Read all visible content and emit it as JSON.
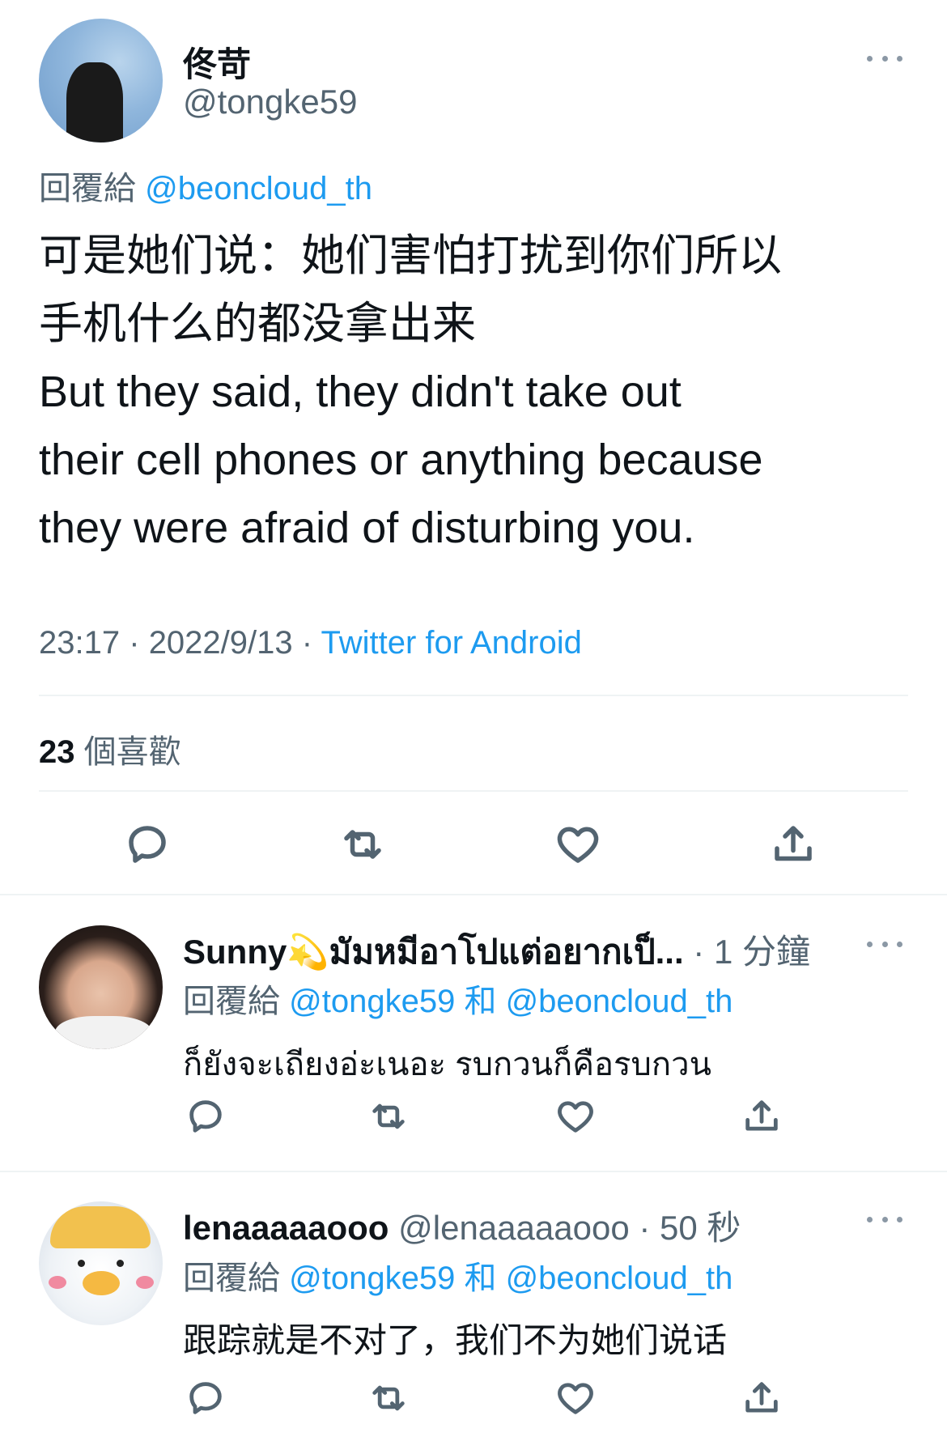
{
  "main_tweet": {
    "author_name": "佟苛",
    "author_handle": "@tongke59",
    "reply_prefix": "回覆給",
    "reply_to": "@beoncloud_th",
    "text_line1": "可是她们说：她们害怕打扰到你们所以",
    "text_line2": "手机什么的都没拿出来",
    "text_line3": "But they said, they didn't take out",
    "text_line4": "their cell phones or anything because",
    "text_line5": "they were afraid of disturbing you.",
    "time": "23:17",
    "separator": "·",
    "date": "2022/9/13",
    "source": "Twitter for Android",
    "likes_count": "23",
    "likes_label": "個喜歡"
  },
  "replies": [
    {
      "author_name": "Sunny💫มัมหมีอาโปแต่อยากเป็...",
      "author_handle": "",
      "time": "· 1 分鐘",
      "reply_prefix": "回覆給",
      "reply_to_1": "@tongke59",
      "conjunction": "和",
      "reply_to_2": "@beoncloud_th",
      "text": "ก็ยังจะเถียงอ่ะเนอะ รบกวนก็คือรบกวน"
    },
    {
      "author_name": "lenaaaaaooo",
      "author_handle": "@lenaaaaaooo",
      "time": "· 50 秒",
      "reply_prefix": "回覆給",
      "reply_to_1": "@tongke59",
      "conjunction": "和",
      "reply_to_2": "@beoncloud_th",
      "text": "跟踪就是不对了，我们不为她们说话"
    }
  ],
  "icons": {
    "reply": "reply-icon",
    "retweet": "retweet-icon",
    "like": "heart-icon",
    "share": "share-icon",
    "more": "more-icon"
  },
  "colors": {
    "accent": "#1d9bf0",
    "secondary_text": "#536471",
    "divider": "#eff3f4"
  }
}
